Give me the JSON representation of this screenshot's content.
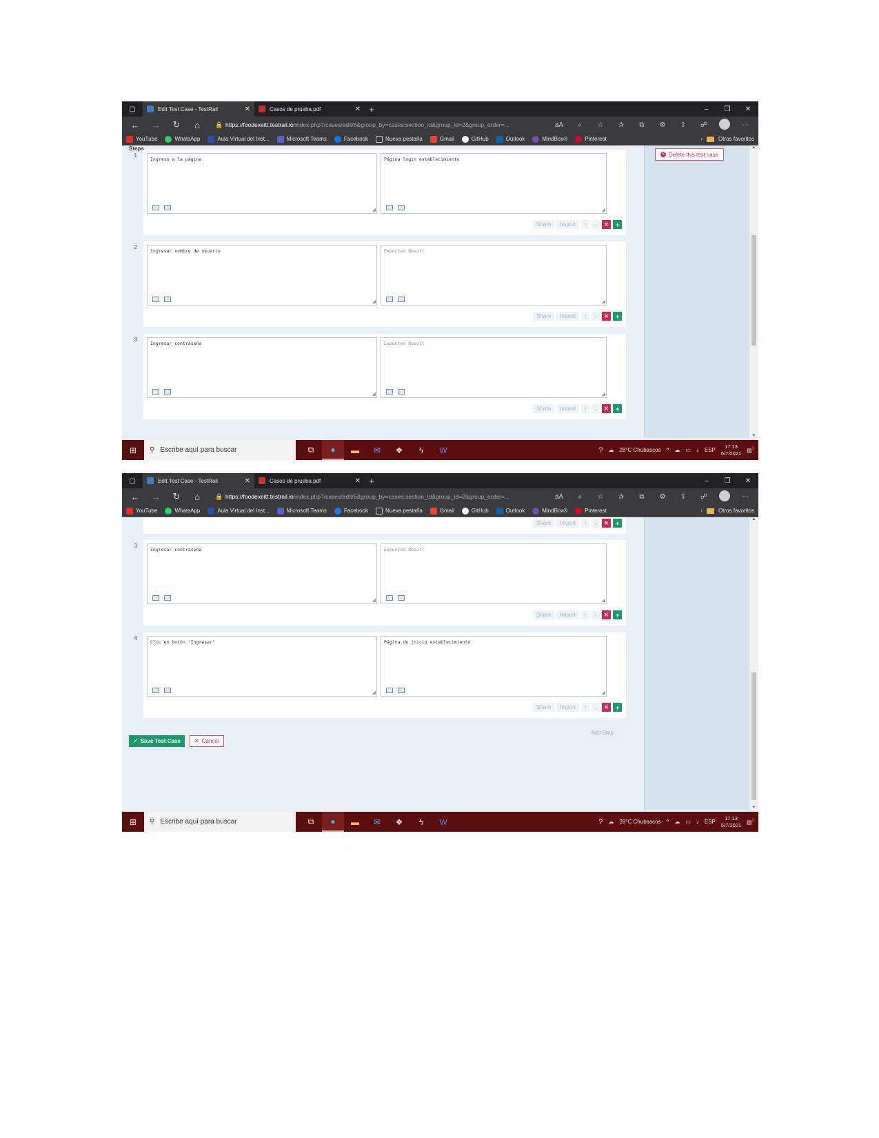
{
  "browser": {
    "tabs": [
      {
        "title": "Edit Test Case - TestRail",
        "favicon_color": "#3d7dc6"
      },
      {
        "title": "Casos de prueba.pdf",
        "favicon_color": "#c9302c"
      }
    ],
    "url_host": "https://foodexeitt.testrail.io",
    "url_path": "/index.php?/cases/edit/6&group_by=cases:section_id&group_id=2&group_order=...",
    "bookmarks": [
      {
        "label": "YouTube",
        "color": "#e52d27"
      },
      {
        "label": "WhatsApp",
        "color": "#25d366"
      },
      {
        "label": "Aula Virtual del Inst...",
        "color": "#2d4da8"
      },
      {
        "label": "Microsoft Teams",
        "color": "#5b5fc7"
      },
      {
        "label": "Facebook",
        "color": "#1877f2"
      },
      {
        "label": "Nueva pestaña",
        "color": "#c8c8c8"
      },
      {
        "label": "Gmail",
        "color": "#ea4335"
      },
      {
        "label": "GitHub",
        "color": "#ffffff"
      },
      {
        "label": "Outlook",
        "color": "#0a64ad"
      },
      {
        "label": "MindBox®",
        "color": "#6c4fb3"
      },
      {
        "label": "Pinterest",
        "color": "#e60023"
      }
    ],
    "other_favorites": "Otros favoritos"
  },
  "page": {
    "steps_label": "Steps",
    "delete_label": "Delete this test case",
    "share_label": "Share",
    "import_label": "Import",
    "add_step_label": "Add Step",
    "save_label": "Save Test Case",
    "cancel_label": "Cancel",
    "expected_placeholder": "Expected Result"
  },
  "screens": [
    {
      "steps": [
        {
          "number": "1",
          "content": "Ingreso a la página",
          "expected": "Página login establecimiento"
        },
        {
          "number": "2",
          "content": "Ingresar nombre de usuario",
          "expected": ""
        },
        {
          "number": "3",
          "content": "Ingresar contraseña",
          "expected": ""
        }
      ]
    },
    {
      "steps": [
        {
          "number": "3",
          "content": "Ingresar contraseña",
          "expected": ""
        },
        {
          "number": "4",
          "content": "Clic en botón \"Ingresar\"",
          "expected": "Página de inicio establecimiento"
        }
      ]
    }
  ],
  "taskbar": {
    "search_placeholder": "Escribe aquí para buscar",
    "weather": "28°C  Chubascos",
    "language": "ESP",
    "time": "17:13",
    "date": "5/7/2021",
    "notifications": "3"
  }
}
